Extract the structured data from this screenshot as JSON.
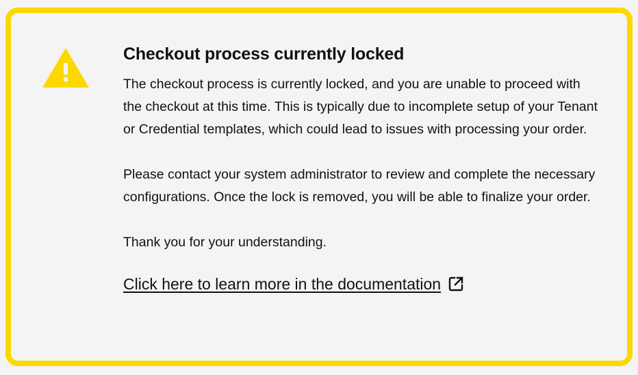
{
  "alert": {
    "icon": "warning-triangle-icon",
    "title": "Checkout process currently locked",
    "paragraphs": [
      "The checkout process is currently locked, and you are unable to proceed with the checkout at this time. This is typically due to incomplete setup of your Tenant or Credential templates, which could lead to issues with processing your order.",
      "Please contact your system administrator to review and complete the necessary configurations. Once the lock is removed, you will be able to finalize your order.",
      "Thank you for your understanding."
    ],
    "link": {
      "label": "Click here to learn more in the documentation",
      "icon": "external-link-icon"
    }
  },
  "colors": {
    "border": "#fcd800",
    "warning_icon": "#fcd800",
    "background": "#f4f4f4",
    "text": "#111111"
  }
}
